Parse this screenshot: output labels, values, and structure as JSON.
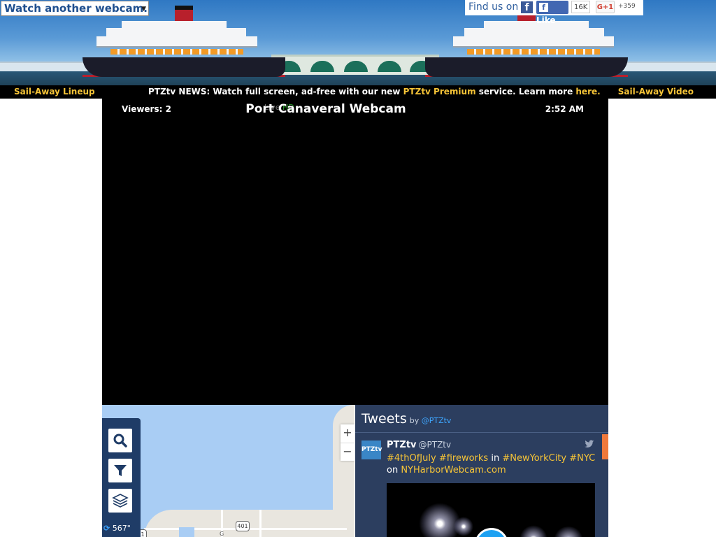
{
  "header": {
    "webcam_select": "Watch another webcam...",
    "social": {
      "find_us_label": "Find us on",
      "facebook_like_label": "Like",
      "facebook_like_count": "16K",
      "google_plus_label": "G+1",
      "google_plus_count": "+359"
    }
  },
  "newsbar": {
    "left_link": "Sail-Away Lineup",
    "news_prefix": "PTZtv NEWS: Watch full screen, ad-free with our new ",
    "news_link": "PTZtv Premium",
    "news_mid": " service. Learn more ",
    "news_here": "here.",
    "right_link": "Sail-Away Video"
  },
  "player": {
    "viewers": "Viewers: 2",
    "title": "Port Canaveral Webcam",
    "time": "2:52 AM",
    "overlay_text": "Live",
    "overlay_green": "HD"
  },
  "map": {
    "refresh_label": "567\"",
    "zoom_in": "+",
    "zoom_out": "−",
    "route_shield": "401",
    "route_shield_left": "1",
    "route_label_g": "G"
  },
  "tweets": {
    "header_title": "Tweets",
    "header_by": "by",
    "header_handle": "@PTZtv",
    "tweet": {
      "avatar_text": "PTZtv",
      "name": "PTZtv",
      "handle": "@PTZtv",
      "parts": {
        "tag1": "#4thOfJuly",
        "tag2": "#fireworks",
        "in": " in ",
        "tag3": "#NewYorkCity",
        "tag4": "#NYC",
        "on": " on ",
        "link": "NYHarborWebcam.com"
      }
    }
  },
  "colors": {
    "news_highlight": "#f6c437",
    "tweets_bg": "#2c3e5f",
    "map_tools_bg": "#1f3c67",
    "twitter_blue": "#1da1f2"
  },
  "icons": [
    "search-icon",
    "filter-icon",
    "layers-icon",
    "refresh-icon",
    "twitter-bird-icon",
    "facebook-icon",
    "play-icon"
  ]
}
